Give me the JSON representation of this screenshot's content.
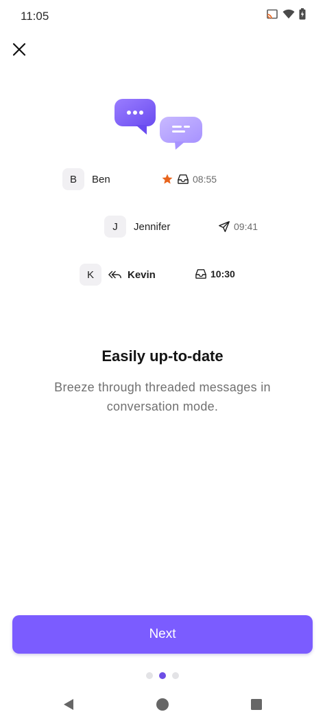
{
  "status_bar": {
    "time": "11:05",
    "icons": [
      "cast-icon",
      "wifi-icon",
      "battery-charging-icon"
    ]
  },
  "header": {
    "close_icon": "close-icon"
  },
  "illustration": {
    "name": "chat-bubbles-illustration",
    "colors": {
      "primary_bubble": "#7b5cff",
      "secondary_bubble": "#b9a8ff"
    }
  },
  "conversations": [
    {
      "initial": "B",
      "name": "Ben",
      "icons": [
        "star-icon",
        "inbox-icon"
      ],
      "time": "08:55",
      "bold": false
    },
    {
      "initial": "J",
      "name": "Jennifer",
      "icons": [
        "sent-icon"
      ],
      "time": "09:41",
      "bold": false
    },
    {
      "initial": "K",
      "name": "Kevin",
      "icons": [
        "reply-all-icon",
        "inbox-icon"
      ],
      "time": "10:30",
      "bold": true
    }
  ],
  "content": {
    "title": "Easily up-to-date",
    "description": "Breeze through threaded messages in conversation mode."
  },
  "actions": {
    "next_label": "Next"
  },
  "pagination": {
    "total": 3,
    "current": 2
  },
  "colors": {
    "accent": "#7b5cff",
    "star": "#e8641c",
    "dot_active": "#6d4ee6"
  },
  "system_nav": [
    "back-icon",
    "home-icon",
    "recents-icon"
  ]
}
